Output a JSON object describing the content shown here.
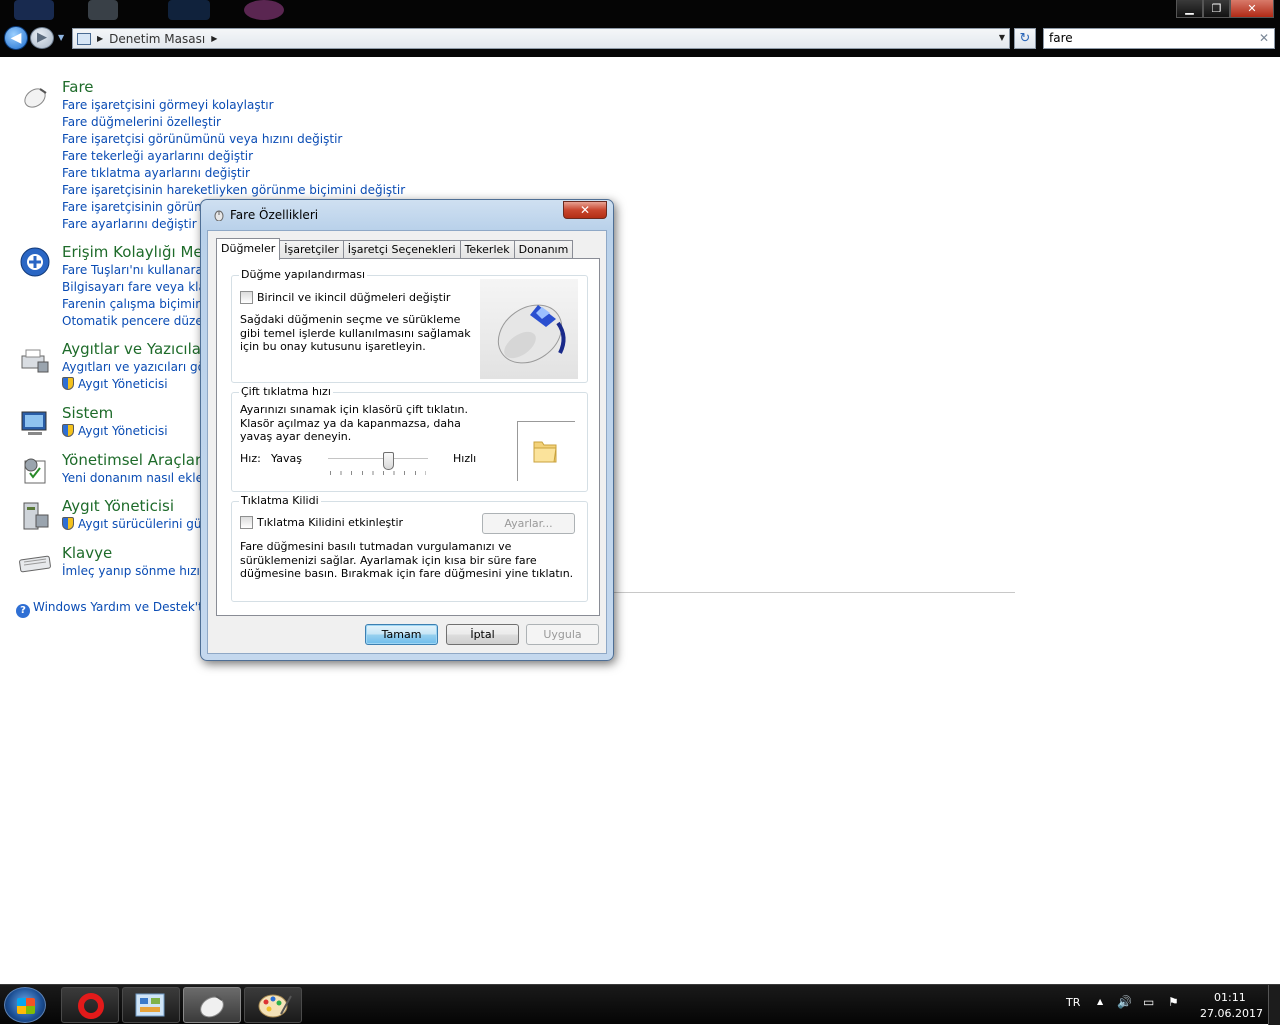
{
  "explorer": {
    "breadcrumb": "Denetim Masası",
    "search_value": "fare",
    "window_controls": {
      "minimize": "▁",
      "maximize": "❐",
      "close": "✕"
    }
  },
  "results": [
    {
      "title": "Fare",
      "icon": "mouse-icon",
      "links": [
        "Fare işaretçisini görmeyi kolaylaştır",
        "Fare düğmelerini özelleştir",
        "Fare işaretçisi görünümünü veya hızını değiştir",
        "Fare tekerleği ayarlarını değiştir",
        "Fare tıklatma ayarlarını değiştir",
        "Fare işaretçisinin hareketliyken görünme biçimini değiştir",
        "Fare işaretçisinin görünm",
        "Fare ayarlarını değiştir"
      ]
    },
    {
      "title": "Erişim Kolaylığı Mer",
      "icon": "ease-of-access-icon",
      "links": [
        "Fare Tuşları'nı kullanarak i",
        "Bilgisayarı fare veya klavye",
        "Farenin çalışma biçimini d",
        "Otomatik pencere düzenle"
      ]
    },
    {
      "title": "Aygıtlar ve Yazıcılar",
      "icon": "devices-printers-icon",
      "links": [
        "Aygıtları ve yazıcıları görün"
      ],
      "shield_links": [
        "Aygıt Yöneticisi"
      ]
    },
    {
      "title": "Sistem",
      "icon": "system-icon",
      "links": [],
      "shield_links": [
        "Aygıt Yöneticisi"
      ]
    },
    {
      "title": "Yönetimsel Araçlar",
      "icon": "admin-tools-icon",
      "links": [
        "Yeni donanım nasıl eklenir"
      ]
    },
    {
      "title": "Aygıt Yöneticisi",
      "icon": "device-manager-icon",
      "links": [],
      "shield_links": [
        "Aygıt sürücülerini günc"
      ]
    },
    {
      "title": "Klavye",
      "icon": "keyboard-icon",
      "links": [
        "İmleç yanıp sönme hızını d"
      ]
    }
  ],
  "help_link": "Windows Yardım ve Destek'te \"f",
  "dialog": {
    "title": "Fare Özellikleri",
    "close": "✕",
    "tabs": [
      "Düğmeler",
      "İşaretçiler",
      "İşaretçi Seçenekleri",
      "Tekerlek",
      "Donanım"
    ],
    "active_tab": "Düğmeler",
    "button_config": {
      "label": "Düğme yapılandırması",
      "checkbox": "Birincil ve ikincil düğmeleri değiştir",
      "checked": false,
      "description": "Sağdaki düğmenin seçme ve sürükleme gibi temel işlerde kullanılmasını sağlamak için bu onay kutusunu işaretleyin."
    },
    "double_click": {
      "label": "Çift tıklatma hızı",
      "description": "Ayarınızı sınamak için klasörü çift tıklatın. Klasör açılmaz ya da kapanmazsa, daha yavaş ayar deneyin.",
      "speed_label": "Hız:",
      "slow": "Yavaş",
      "fast": "Hızlı",
      "speed_value": 0.6
    },
    "click_lock": {
      "label": "Tıklatma Kilidi",
      "checkbox": "Tıklatma Kilidini etkinleştir",
      "checked": false,
      "settings_button": "Ayarlar...",
      "description": "Fare düğmesini basılı tutmadan vurgulamanızı ve sürüklemenizi sağlar. Ayarlamak için kısa bir süre fare düğmesine basın. Bırakmak için fare düğmesini yine tıklatın."
    },
    "buttons": {
      "ok": "Tamam",
      "cancel": "İptal",
      "apply": "Uygula"
    }
  },
  "taskbar": {
    "language": "TR",
    "time": "01:11",
    "date": "27.06.2017"
  }
}
